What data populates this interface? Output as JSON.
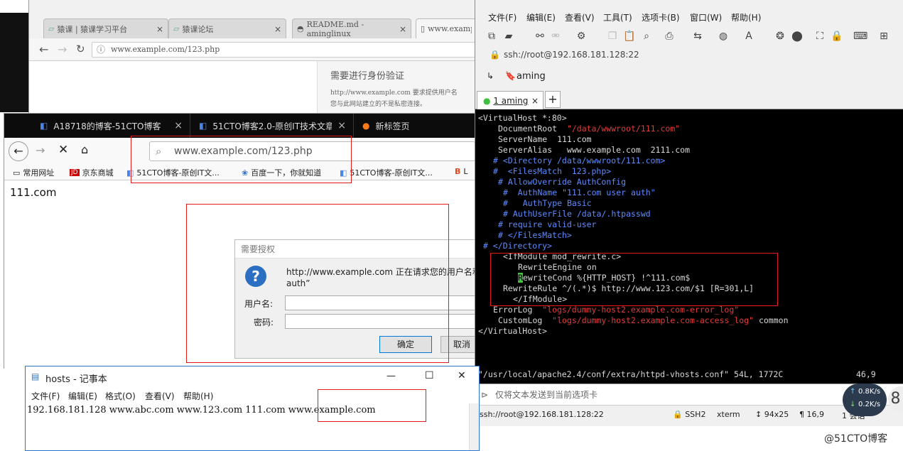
{
  "chrome": {
    "tabs": [
      {
        "label": "猿课 | 猿课学习平台",
        "close": "×"
      },
      {
        "label": "猿课论坛",
        "close": "×"
      },
      {
        "label": "README.md - aminglinux",
        "close": "×"
      },
      {
        "label": "www.exampl",
        "close": ""
      }
    ],
    "url": "www.example.com/123.php",
    "auth_heading": "需要进行身份验证",
    "auth_text_1": "http://www.example.com 要求提供用户名",
    "auth_text_2": "您与此网站建立的不是私密连接。"
  },
  "firefox": {
    "tabs": [
      {
        "label": "A18718的博客-51CTO博客",
        "close": "×"
      },
      {
        "label": "51CTO博客2.0-原创IT技术文章",
        "close": "×"
      },
      {
        "label": "新标签页",
        "close": ""
      }
    ],
    "url": "www.example.com/123.php",
    "bookmarks": [
      "常用网址",
      "京东商城",
      "51CTO博客-原创IT文...",
      "百度一下，你就知道",
      "51CTO博客-原创IT文...",
      "L"
    ],
    "page_text": "111.com",
    "auth_dialog": {
      "title": "需要授权",
      "message_1": "http://www.example.com 正在请求您的用户名和",
      "message_2": "auth”",
      "username_label": "用户名:",
      "password_label": "密码:",
      "ok": "确定",
      "cancel": "取消"
    }
  },
  "securecrt": {
    "menu": [
      "文件(F)",
      "编辑(E)",
      "查看(V)",
      "工具(T)",
      "选项卡(B)",
      "窗口(W)",
      "帮助(H)"
    ],
    "address": "ssh://root@192.168.181.128:22",
    "session_bar_label": "aming",
    "tab_label": "1 aming",
    "tab_plus": "+",
    "terminal_lines": [
      {
        "text": "<VirtualHost *:80>",
        "indent": 0,
        "color": "white"
      },
      {
        "text": "DocumentRoot",
        "indent": 28,
        "color": "white",
        "extra": "\"/data/wwwroot/111.com\"",
        "extra_color": "red"
      },
      {
        "text": "ServerName  111.com",
        "indent": 28,
        "color": "white"
      },
      {
        "text": "ServerAlias   www.example.com  2111.com",
        "indent": 28,
        "color": "white"
      },
      {
        "text": "# <Directory /data/wwwroot/111.com>",
        "indent": 21,
        "color": "blue"
      },
      {
        "text": "#  <FilesMatch  123.php>",
        "indent": 21,
        "color": "blue"
      },
      {
        "text": "# AllowOverride AuthConfig",
        "indent": 28,
        "color": "blue"
      },
      {
        "text": "#  AuthName \"111.com user auth\"",
        "indent": 35,
        "color": "blue"
      },
      {
        "text": "#   AuthType Basic",
        "indent": 35,
        "color": "blue"
      },
      {
        "text": "# AuthUserFile /data/.htpasswd",
        "indent": 35,
        "color": "blue"
      },
      {
        "text": "# require valid-user",
        "indent": 28,
        "color": "blue"
      },
      {
        "text": "# </FilesMatch>",
        "indent": 28,
        "color": "blue"
      },
      {
        "text": "# </Directory>",
        "indent": 7,
        "color": "blue"
      },
      {
        "text": "<IfModule mod_rewrite.c>",
        "indent": 35,
        "color": "white"
      },
      {
        "text": "RewriteEngine on",
        "indent": 56,
        "color": "white"
      },
      {
        "text": "RewriteCond %{HTTP_HOST} !^111.com$",
        "indent": 56,
        "color": "white",
        "cursor": true
      },
      {
        "text": "RewriteRule ^/(.*)$ http://www.123.com/$1 [R=301,L]",
        "indent": 35,
        "color": "white"
      },
      {
        "text": "</IfModule>",
        "indent": 49,
        "color": "white"
      },
      {
        "text": "ErrorLog",
        "indent": 21,
        "color": "white",
        "extra": "\"logs/dummy-host2.example.com-error_log\"",
        "extra_color": "red"
      },
      {
        "text": "CustomLog",
        "indent": 28,
        "color": "white",
        "extra": "\"logs/dummy-host2.example.com-access_log\"",
        "extra_color": "red",
        "tail": " common"
      },
      {
        "text": "</VirtualHost>",
        "indent": 0,
        "color": "white"
      }
    ],
    "vim_status_file": "\"/usr/local/apache2.4/conf/extra/httpd-vhosts.conf\" 54L, 1772C",
    "vim_status_pos": "46,9",
    "send_bar_text": "仅将文本发送到当前选项卡",
    "status": {
      "address": "ssh://root@192.168.181.128:22",
      "protocol": "SSH2",
      "terminal": "xterm",
      "size": "94x25",
      "cursor": "16,9",
      "sessions": "1 会话"
    }
  },
  "notepad": {
    "title": "hosts - 记事本",
    "menu": [
      "文件(F)",
      "编辑(E)",
      "格式(O)",
      "查看(V)",
      "帮助(H)"
    ],
    "content": "192.168.181.128  www.abc.com  www.123.com  111.com  www.example.com",
    "min": "—",
    "max": "☐",
    "close": "✕"
  },
  "net_widget": {
    "up": "0.8K/s",
    "down": "0.2K/s",
    "badge": "8"
  },
  "watermark": "@51CTO博客",
  "colors": {
    "red_box": "#e21b1b",
    "term_blue": "#5d8bff",
    "term_red": "#e23b3b",
    "firefox_tabbar": "#0c0c0d"
  }
}
